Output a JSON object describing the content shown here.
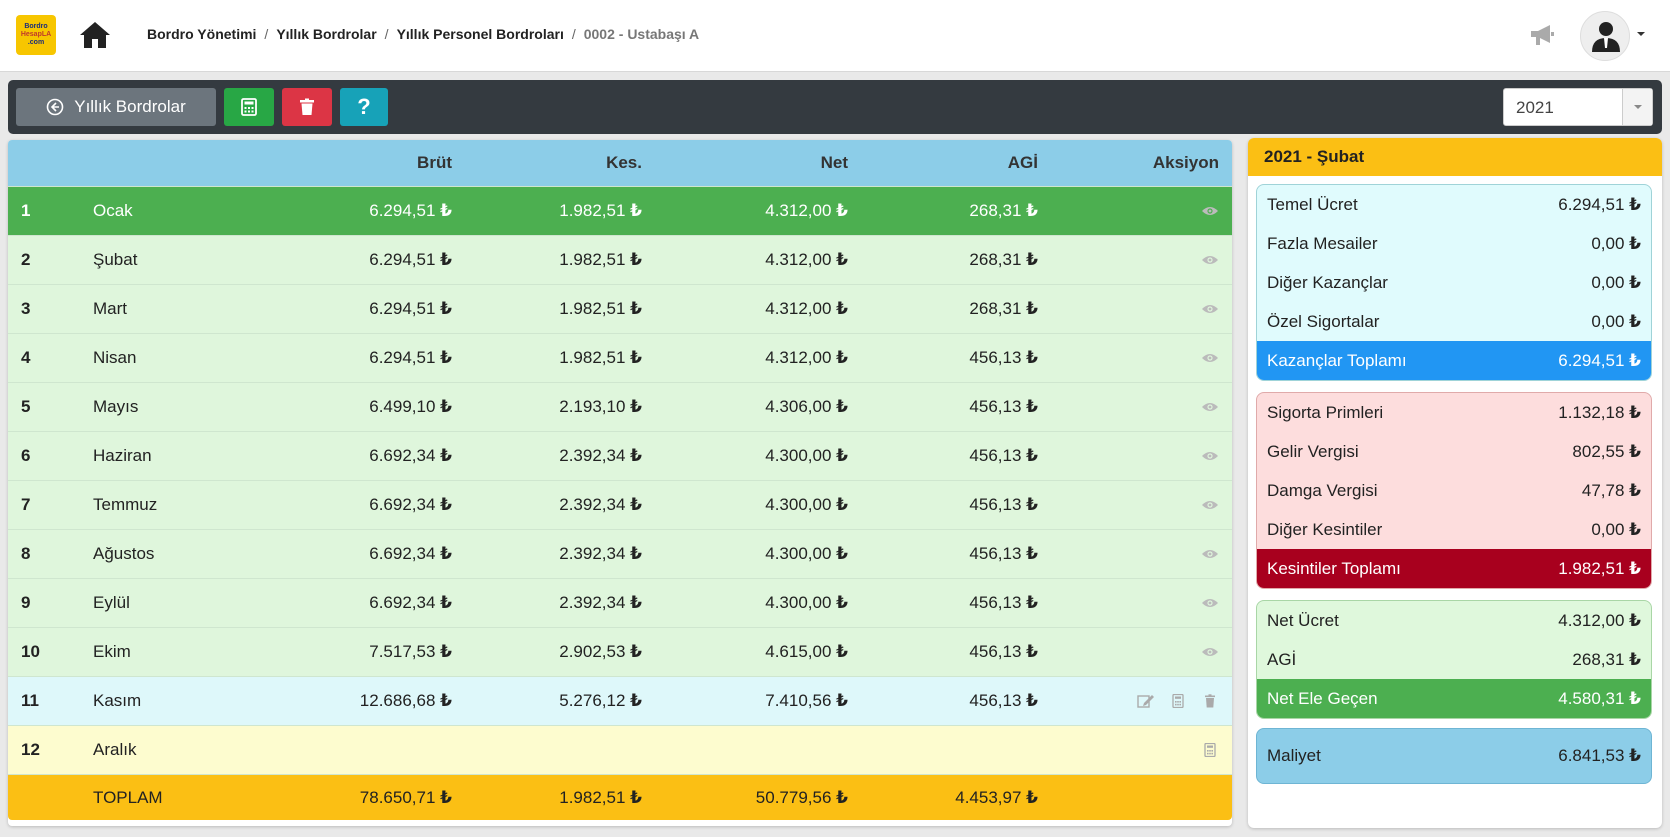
{
  "header": {
    "logo_line1": "Bordro",
    "logo_line2": "HesapLA",
    "logo_line3": ".com",
    "breadcrumb": [
      "Bordro Yönetimi",
      "Yıllık Bordrolar",
      "Yıllık Personel Bordroları",
      "0002 - Ustabaşı A"
    ]
  },
  "toolbar": {
    "back_label": "Yıllık Bordrolar",
    "help_label": "?",
    "year": "2021"
  },
  "currency": "₺",
  "table": {
    "headers": {
      "no": "",
      "month": "",
      "brut": "Brüt",
      "kes": "Kes.",
      "net": "Net",
      "agi": "AGİ",
      "action": "Aksiyon"
    },
    "rows": [
      {
        "no": "1",
        "month": "Ocak",
        "brut": "6.294,51",
        "kes": "1.982,51",
        "net": "4.312,00",
        "agi": "268,31"
      },
      {
        "no": "2",
        "month": "Şubat",
        "brut": "6.294,51",
        "kes": "1.982,51",
        "net": "4.312,00",
        "agi": "268,31"
      },
      {
        "no": "3",
        "month": "Mart",
        "brut": "6.294,51",
        "kes": "1.982,51",
        "net": "4.312,00",
        "agi": "268,31"
      },
      {
        "no": "4",
        "month": "Nisan",
        "brut": "6.294,51",
        "kes": "1.982,51",
        "net": "4.312,00",
        "agi": "456,13"
      },
      {
        "no": "5",
        "month": "Mayıs",
        "brut": "6.499,10",
        "kes": "2.193,10",
        "net": "4.306,00",
        "agi": "456,13"
      },
      {
        "no": "6",
        "month": "Haziran",
        "brut": "6.692,34",
        "kes": "2.392,34",
        "net": "4.300,00",
        "agi": "456,13"
      },
      {
        "no": "7",
        "month": "Temmuz",
        "brut": "6.692,34",
        "kes": "2.392,34",
        "net": "4.300,00",
        "agi": "456,13"
      },
      {
        "no": "8",
        "month": "Ağustos",
        "brut": "6.692,34",
        "kes": "2.392,34",
        "net": "4.300,00",
        "agi": "456,13"
      },
      {
        "no": "9",
        "month": "Eylül",
        "brut": "6.692,34",
        "kes": "2.392,34",
        "net": "4.300,00",
        "agi": "456,13"
      },
      {
        "no": "10",
        "month": "Ekim",
        "brut": "7.517,53",
        "kes": "2.902,53",
        "net": "4.615,00",
        "agi": "456,13"
      },
      {
        "no": "11",
        "month": "Kasım",
        "brut": "12.686,68",
        "kes": "5.276,12",
        "net": "7.410,56",
        "agi": "456,13"
      },
      {
        "no": "12",
        "month": "Aralık",
        "brut": "",
        "kes": "",
        "net": "",
        "agi": ""
      }
    ],
    "total": {
      "label": "TOPLAM",
      "brut": "78.650,71",
      "kes": "1.982,51",
      "net": "50.779,56",
      "agi": "4.453,97"
    }
  },
  "summary": {
    "title": "2021 - Şubat",
    "earnings": [
      {
        "label": "Temel Ücret",
        "value": "6.294,51"
      },
      {
        "label": "Fazla Mesailer",
        "value": "0,00"
      },
      {
        "label": "Diğer Kazançlar",
        "value": "0,00"
      },
      {
        "label": "Özel Sigortalar",
        "value": "0,00"
      }
    ],
    "earnings_total": {
      "label": "Kazançlar Toplamı",
      "value": "6.294,51"
    },
    "deductions": [
      {
        "label": "Sigorta Primleri",
        "value": "1.132,18"
      },
      {
        "label": "Gelir Vergisi",
        "value": "802,55"
      },
      {
        "label": "Damga Vergisi",
        "value": "47,78"
      },
      {
        "label": "Diğer Kesintiler",
        "value": "0,00"
      }
    ],
    "deductions_total": {
      "label": "Kesintiler Toplamı",
      "value": "1.982,51"
    },
    "net": [
      {
        "label": "Net Ücret",
        "value": "4.312,00"
      },
      {
        "label": "AGİ",
        "value": "268,31"
      }
    ],
    "net_total": {
      "label": "Net Ele Geçen",
      "value": "4.580,31"
    },
    "cost": {
      "label": "Maliyet",
      "value": "6.841,53"
    }
  }
}
